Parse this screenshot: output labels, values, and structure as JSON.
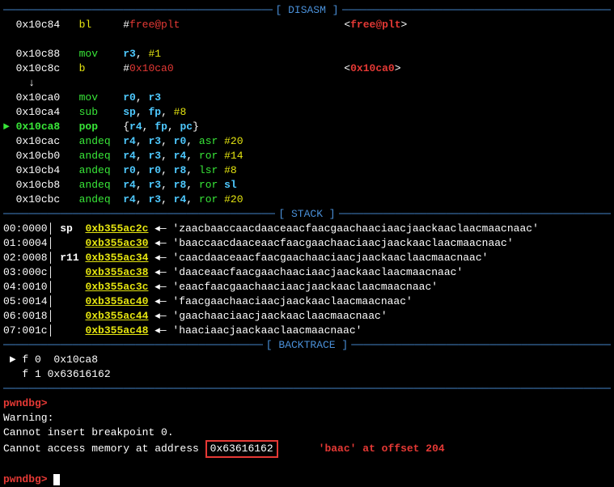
{
  "sections": {
    "disasm": "[ DISASM ]",
    "stack": "[ STACK ]",
    "backtrace": "[ BACKTRACE ]"
  },
  "disasm": [
    {
      "marker": " ",
      "addr": "0x10c84",
      "mn": "bl",
      "mncls": "mn-yellow",
      "ops": [
        {
          "t": "#",
          "c": "w"
        },
        {
          "t": "free@plt",
          "c": "fn"
        }
      ],
      "rhs": {
        "prefix": "<",
        "fn": "free@plt",
        "suffix": ">"
      }
    },
    {
      "blank": true
    },
    {
      "marker": " ",
      "addr": "0x10c88",
      "mn": "mov",
      "mncls": "mn-green",
      "ops": [
        {
          "t": "r3",
          "c": "reg"
        },
        {
          "t": ", ",
          "c": "w"
        },
        {
          "t": "#1",
          "c": "num"
        }
      ]
    },
    {
      "marker": " ",
      "addr": "0x10c8c",
      "mn": "b",
      "mncls": "mn-yellow",
      "ops": [
        {
          "t": "#",
          "c": "w"
        },
        {
          "t": "0x10ca0",
          "c": "hexred"
        }
      ],
      "rhs": {
        "prefix": "<",
        "hex": "0x10ca0",
        "suffix": ">"
      }
    },
    {
      "downarrow": true
    },
    {
      "marker": " ",
      "addr": "0x10ca0",
      "mn": "mov",
      "mncls": "mn-green",
      "ops": [
        {
          "t": "r0",
          "c": "reg"
        },
        {
          "t": ", ",
          "c": "w"
        },
        {
          "t": "r3",
          "c": "reg"
        }
      ]
    },
    {
      "marker": " ",
      "addr": "0x10ca4",
      "mn": "sub",
      "mncls": "mn-green",
      "ops": [
        {
          "t": "sp",
          "c": "reg"
        },
        {
          "t": ", ",
          "c": "w"
        },
        {
          "t": "fp",
          "c": "reg"
        },
        {
          "t": ", ",
          "c": "w"
        },
        {
          "t": "#8",
          "c": "num"
        }
      ]
    },
    {
      "marker": "►",
      "addr": "0x10ca8",
      "addrcls": "addr-hi",
      "mn": "pop",
      "mncls": "mn-green-b",
      "ops": [
        {
          "t": "{",
          "c": "w"
        },
        {
          "t": "r4",
          "c": "reg"
        },
        {
          "t": ", ",
          "c": "w"
        },
        {
          "t": "fp",
          "c": "reg"
        },
        {
          "t": ", ",
          "c": "w"
        },
        {
          "t": "pc",
          "c": "reg"
        },
        {
          "t": "}",
          "c": "w"
        }
      ]
    },
    {
      "marker": " ",
      "addr": "0x10cac",
      "mn": "andeq",
      "mncls": "mn-green",
      "ops": [
        {
          "t": "r4",
          "c": "reg"
        },
        {
          "t": ", ",
          "c": "w"
        },
        {
          "t": "r3",
          "c": "reg"
        },
        {
          "t": ", ",
          "c": "w"
        },
        {
          "t": "r0",
          "c": "reg"
        },
        {
          "t": ", ",
          "c": "w"
        },
        {
          "t": "asr",
          "c": "kw"
        },
        {
          "t": " ",
          "c": "w"
        },
        {
          "t": "#20",
          "c": "num"
        }
      ]
    },
    {
      "marker": " ",
      "addr": "0x10cb0",
      "mn": "andeq",
      "mncls": "mn-green",
      "ops": [
        {
          "t": "r4",
          "c": "reg"
        },
        {
          "t": ", ",
          "c": "w"
        },
        {
          "t": "r3",
          "c": "reg"
        },
        {
          "t": ", ",
          "c": "w"
        },
        {
          "t": "r4",
          "c": "reg"
        },
        {
          "t": ", ",
          "c": "w"
        },
        {
          "t": "ror",
          "c": "kw"
        },
        {
          "t": " ",
          "c": "w"
        },
        {
          "t": "#14",
          "c": "num"
        }
      ]
    },
    {
      "marker": " ",
      "addr": "0x10cb4",
      "mn": "andeq",
      "mncls": "mn-green",
      "ops": [
        {
          "t": "r0",
          "c": "reg"
        },
        {
          "t": ", ",
          "c": "w"
        },
        {
          "t": "r0",
          "c": "reg"
        },
        {
          "t": ", ",
          "c": "w"
        },
        {
          "t": "r8",
          "c": "reg"
        },
        {
          "t": ", ",
          "c": "w"
        },
        {
          "t": "lsr",
          "c": "kw"
        },
        {
          "t": " ",
          "c": "w"
        },
        {
          "t": "#8",
          "c": "num"
        }
      ]
    },
    {
      "marker": " ",
      "addr": "0x10cb8",
      "mn": "andeq",
      "mncls": "mn-green",
      "ops": [
        {
          "t": "r4",
          "c": "reg"
        },
        {
          "t": ", ",
          "c": "w"
        },
        {
          "t": "r3",
          "c": "reg"
        },
        {
          "t": ", ",
          "c": "w"
        },
        {
          "t": "r8",
          "c": "reg"
        },
        {
          "t": ", ",
          "c": "w"
        },
        {
          "t": "ror",
          "c": "kw"
        },
        {
          "t": " ",
          "c": "w"
        },
        {
          "t": "sl",
          "c": "reg"
        }
      ]
    },
    {
      "marker": " ",
      "addr": "0x10cbc",
      "mn": "andeq",
      "mncls": "mn-green",
      "ops": [
        {
          "t": "r4",
          "c": "reg"
        },
        {
          "t": ", ",
          "c": "w"
        },
        {
          "t": "r3",
          "c": "reg"
        },
        {
          "t": ", ",
          "c": "w"
        },
        {
          "t": "r4",
          "c": "reg"
        },
        {
          "t": ", ",
          "c": "w"
        },
        {
          "t": "ror",
          "c": "kw"
        },
        {
          "t": " ",
          "c": "w"
        },
        {
          "t": "#20",
          "c": "num"
        }
      ]
    }
  ],
  "stack": [
    {
      "idx": "00:0000",
      "reg": "sp ",
      "addr": "0xb355ac2c",
      "data": "'zaacbaaccaacdaaceaacfaacgaachaaciaacjaackaaclaacmaacnaac'"
    },
    {
      "idx": "01:0004",
      "reg": "   ",
      "addr": "0xb355ac30",
      "data": "'baaccaacdaaceaacfaacgaachaaciaacjaackaaclaacmaacnaac'"
    },
    {
      "idx": "02:0008",
      "reg": "r11",
      "addr": "0xb355ac34",
      "data": "'caacdaaceaacfaacgaachaaciaacjaackaaclaacmaacnaac'"
    },
    {
      "idx": "03:000c",
      "reg": "   ",
      "addr": "0xb355ac38",
      "data": "'daaceaacfaacgaachaaciaacjaackaaclaacmaacnaac'"
    },
    {
      "idx": "04:0010",
      "reg": "   ",
      "addr": "0xb355ac3c",
      "data": "'eaacfaacgaachaaciaacjaackaaclaacmaacnaac'"
    },
    {
      "idx": "05:0014",
      "reg": "   ",
      "addr": "0xb355ac40",
      "data": "'faacgaachaaciaacjaackaaclaacmaacnaac'"
    },
    {
      "idx": "06:0018",
      "reg": "   ",
      "addr": "0xb355ac44",
      "data": "'gaachaaciaacjaackaaclaacmaacnaac'"
    },
    {
      "idx": "07:001c",
      "reg": "   ",
      "addr": "0xb355ac48",
      "data": "'haaciaacjaackaaclaacmaacnaac'"
    }
  ],
  "backtrace": [
    {
      "marker": "►",
      "text": "f 0  0x10ca8"
    },
    {
      "marker": " ",
      "text": "f 1 0x63616162"
    }
  ],
  "prompt": "pwndbg>",
  "output": {
    "warn": "Warning:",
    "l1": "Cannot insert breakpoint 0.",
    "l2a": "Cannot access memory at address ",
    "l2b": "0x63616162"
  },
  "annotation": "'baac' at offset 204"
}
